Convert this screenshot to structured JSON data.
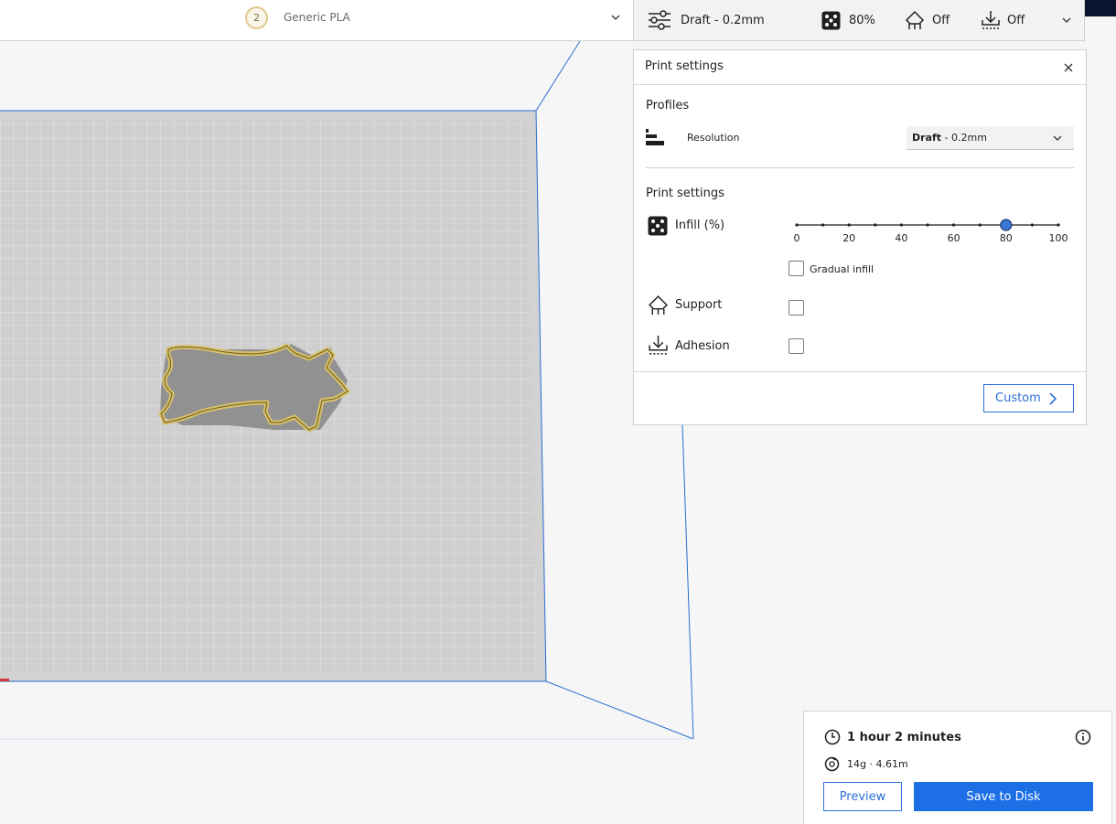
{
  "topbar": {
    "extruder_number": "2",
    "material_name": "Generic PLA",
    "profile_summary": "Draft - 0.2mm",
    "infill_summary": "80%",
    "support_summary": "Off",
    "adhesion_summary": "Off"
  },
  "print_settings_panel": {
    "title": "Print settings",
    "profiles_section": "Profiles",
    "resolution_label": "Resolution",
    "resolution_value_bold": "Draft",
    "resolution_value_rest": " - 0.2mm",
    "settings_section": "Print settings",
    "infill_label": "Infill (%)",
    "infill_value": 80,
    "infill_ticks": [
      "0",
      "20",
      "40",
      "60",
      "80",
      "100"
    ],
    "gradual_infill_label": "Gradual infill",
    "gradual_infill_checked": false,
    "support_label": "Support",
    "support_checked": false,
    "adhesion_label": "Adhesion",
    "adhesion_checked": false,
    "custom_button": "Custom"
  },
  "action_panel": {
    "print_time": "1 hour 2 minutes",
    "material_estimate": "14g · 4.61m",
    "preview_button": "Preview",
    "save_button": "Save to Disk"
  },
  "colors": {
    "accent_blue": "#1d6fe6",
    "model_yellow": "#d8c169",
    "build_plate": "#d9d9d9",
    "volume_edge": "#2b6ed0"
  },
  "icons": [
    "extruder-badge-icon",
    "chevron-down-icon",
    "settings-sliders-icon",
    "infill-icon",
    "support-icon",
    "adhesion-icon",
    "close-icon",
    "resolution-icon",
    "chevron-right-icon",
    "clock-icon",
    "info-icon",
    "spool-icon"
  ]
}
